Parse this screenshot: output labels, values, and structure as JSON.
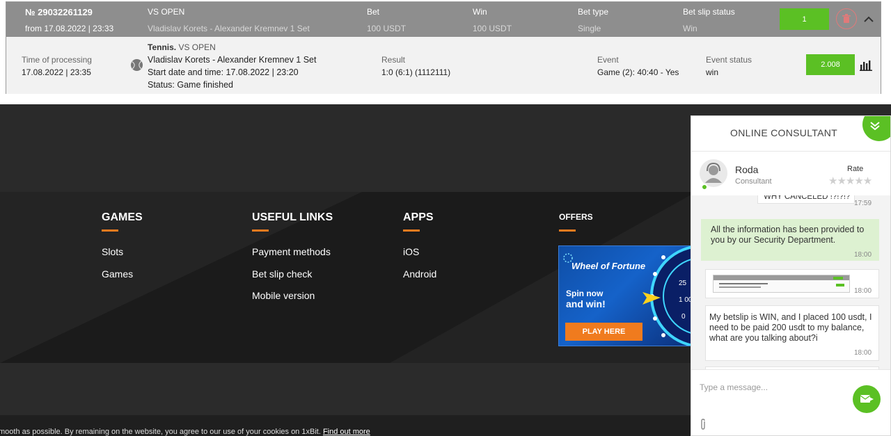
{
  "betslip": {
    "number": "№ 29032261129",
    "date": "from 17.08.2022 | 23:33",
    "event_label": "VS OPEN",
    "event_value": "Vladislav Korets - Alexander Kremnev 1 Set",
    "bet_label": "Bet",
    "bet_value": "100 USDT",
    "win_label": "Win",
    "win_value": "100 USDT",
    "type_label": "Bet type",
    "type_value": "Single",
    "status_label": "Bet slip status",
    "status_value": "Win",
    "count_badge": "1",
    "detail": {
      "processing_label": "Time of processing",
      "processing_value": "17.08.2022 | 23:35",
      "sport": "Tennis.",
      "league": "VS OPEN",
      "match": "Vladislav Korets - Alexander Kremnev 1 Set",
      "start": "Start date and time: 17.08.2022 | 23:20",
      "status": "Status: Game finished",
      "result_label": "Result",
      "result_value": "1:0 (6:1) (1112111)",
      "event_label": "Event",
      "event_value": "Game (2): 40:40 - Yes",
      "event_status_label": "Event status",
      "event_status_value": "win",
      "odds": "2.008"
    }
  },
  "footer": {
    "games_heading": "GAMES",
    "games_items": [
      "Slots",
      "Games"
    ],
    "links_heading": "USEFUL LINKS",
    "links_items": [
      "Payment methods",
      "Bet slip check",
      "Mobile version"
    ],
    "apps_heading": "APPS",
    "apps_items": [
      "iOS",
      "Android"
    ],
    "offers_heading": "OFFERS",
    "banner": {
      "title": "Wheel of Fortune",
      "line1": "Spin now",
      "line2": "and win!",
      "button": "PLAY HERE",
      "wheel_nums": [
        "25",
        "1 00",
        "0"
      ]
    },
    "cookie_text": "mooth as possible. By remaining on the website, you agree to our use of your cookies on 1xBit.",
    "cookie_link": "Find out more"
  },
  "chat": {
    "title": "ONLINE CONSULTANT",
    "agent_name": "Roda",
    "agent_role": "Consultant",
    "rate_label": "Rate",
    "messages": [
      {
        "text": "WHY CANCELED !?!?!?",
        "time": "17:59"
      },
      {
        "text": "All the information has been provided to you by our Security Department.",
        "time": "18:00"
      },
      {
        "text": "",
        "time": "18:00"
      },
      {
        "text": "My betslip is WIN, and I placed 100 usdt, I need to be paid 200 usdt to my balance, what are you talking about?i",
        "time": "18:00"
      }
    ],
    "input_placeholder": "Type a message..."
  },
  "colors": {
    "accent_green": "#5bc024",
    "orange": "#f07b1e",
    "header_gray": "#8e8e8e"
  }
}
